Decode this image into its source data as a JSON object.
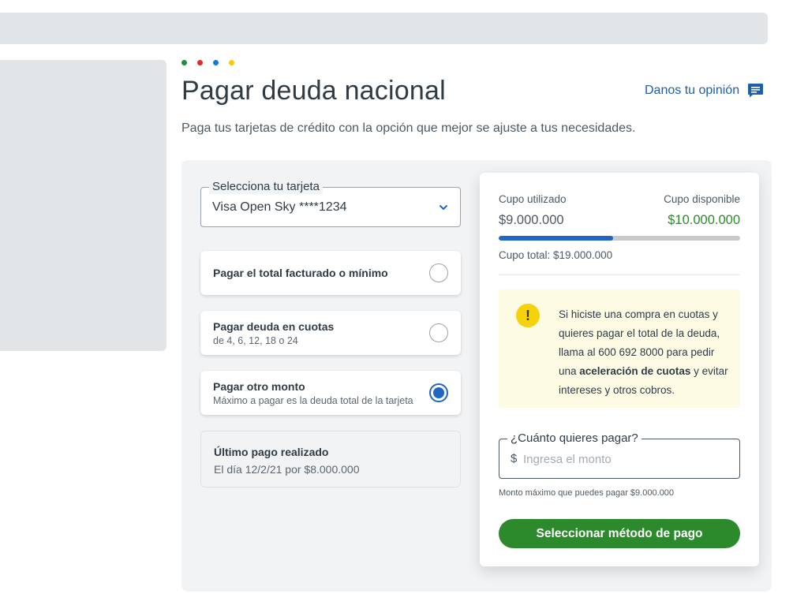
{
  "page": {
    "title": "Pagar deuda nacional",
    "subtitle": "Paga tus tarjetas de crédito con la opción que mejor se ajuste a tus necesidades.",
    "feedback_label": "Danos tu opinión",
    "feedback_icon": "comment-icon",
    "brand_dots": [
      "#1e8e3e",
      "#d93025",
      "#1a73e8",
      "#f9c80e"
    ]
  },
  "card_select": {
    "legend": "Selecciona tu tarjeta",
    "value": "Visa Open Sky ****1234",
    "icon": "chevron-down-icon"
  },
  "payment_options": [
    {
      "title": "Pagar el total facturado o mínimo",
      "subtitle": "",
      "selected": false
    },
    {
      "title": "Pagar deuda en cuotas",
      "subtitle": "de 4, 6, 12, 18 o 24",
      "selected": false
    },
    {
      "title": "Pagar otro monto",
      "subtitle": "Máximo a pagar es la deuda total de la tarjeta",
      "selected": true
    }
  ],
  "last_payment": {
    "title": "Último pago realizado",
    "detail": "El día 12/2/21 por $8.000.000"
  },
  "credit": {
    "used_label": "Cupo utilizado",
    "used_value": "$9.000.000",
    "available_label": "Cupo disponible",
    "available_value": "$10.000.000",
    "used_fraction": 0.4737,
    "total": "Cupo total: $19.000.000"
  },
  "notice": {
    "icon": "exclamation-icon",
    "text_before": "Si hiciste una compra en cuotas y quieres pagar el total de la deuda, llama al 600 692 8000 para pedir una ",
    "text_bold": "aceleración de cuotas",
    "text_after": " y evitar intereses y otros cobros."
  },
  "amount_field": {
    "legend": "¿Cuánto quieres pagar?",
    "currency": "$",
    "placeholder": "Ingresa el monto",
    "value": "",
    "max_note": "Monto máximo que puedes pagar $9.000.000"
  },
  "cta_label": "Seleccionar método de pago",
  "colors": {
    "primary_blue": "#1f66c4",
    "success_green": "#2c8a2c",
    "notice_bg": "#fdfbe3",
    "warning_yellow": "#f5d20a"
  }
}
